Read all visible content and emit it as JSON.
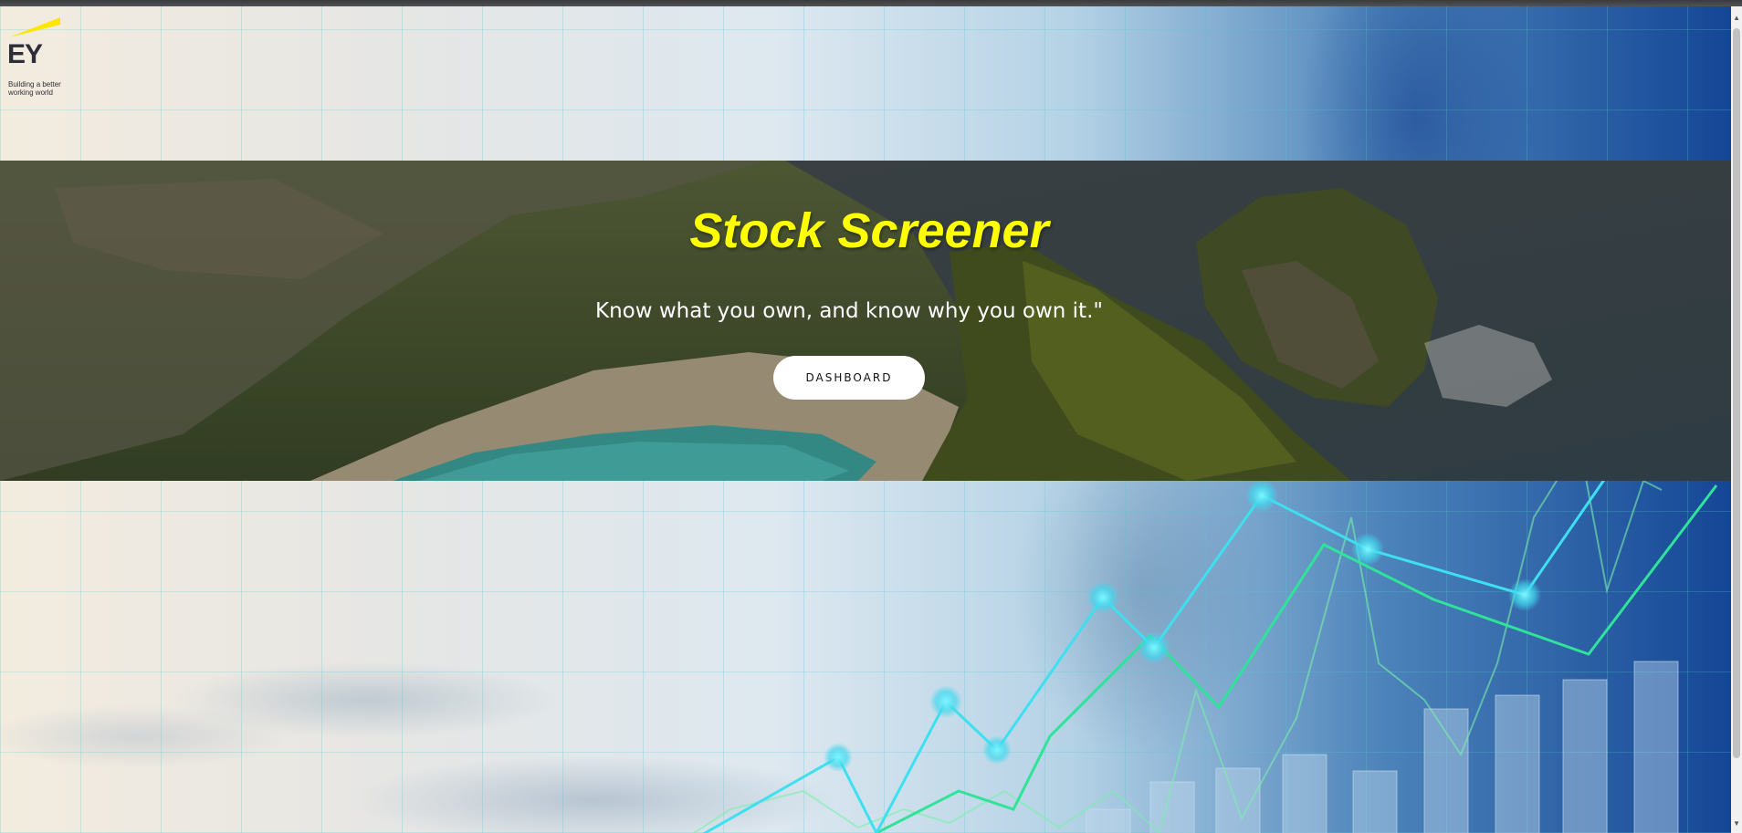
{
  "brand": {
    "logo_text": "EY",
    "tagline": "Building a better working world",
    "accent_color": "#ffe600"
  },
  "hero": {
    "title": "Stock Screener",
    "subtitle": "Know what you own, and know why you own it.\"",
    "button_label": "DASHBOARD",
    "title_color": "#ffff00"
  },
  "icons": {
    "scroll_up": "scroll-up-arrow-icon",
    "scroll_down": "scroll-down-arrow-icon"
  }
}
